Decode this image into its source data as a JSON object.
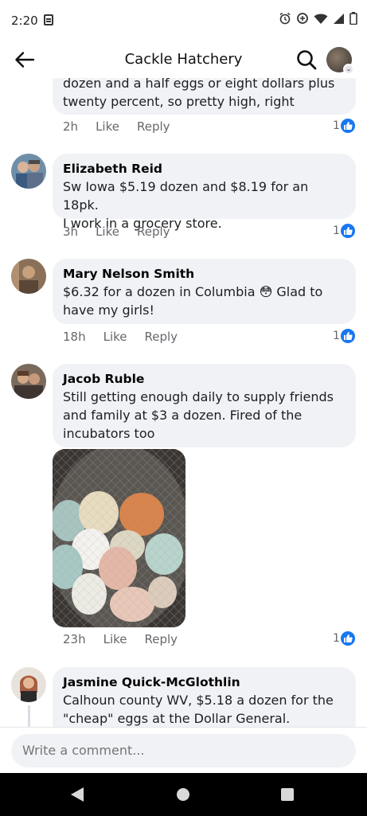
{
  "status_bar": {
    "time": "2:20"
  },
  "header": {
    "title": "Cackle Hatchery"
  },
  "comments": [
    {
      "author": "",
      "text_lines": [
        "dozen and a half eggs or eight dollars plus",
        "twenty percent, so pretty high, right"
      ],
      "time": "2h",
      "like_label": "Like",
      "reply_label": "Reply",
      "reactions": "1"
    },
    {
      "author": "Elizabeth Reid",
      "text_lines": [
        "Sw Iowa $5.19 dozen and $8.19 for an 18pk.",
        "I work in a grocery store."
      ],
      "time": "3h",
      "like_label": "Like",
      "reply_label": "Reply",
      "reactions": "1"
    },
    {
      "author": "Mary Nelson Smith",
      "text_lines": [
        "$6.32 for a dozen in Columbia 😳 Glad to",
        "have my girls!"
      ],
      "time": "18h",
      "like_label": "Like",
      "reply_label": "Reply",
      "reactions": "1"
    },
    {
      "author": "Jacob Ruble",
      "text_lines": [
        "Still getting enough daily to supply friends",
        "and family at $3 a dozen. Fired of the",
        "incubators too"
      ],
      "time": "23h",
      "like_label": "Like",
      "reply_label": "Reply",
      "reactions": "1"
    },
    {
      "author": "Jasmine Quick-McGlothlin",
      "text_lines": [
        "Calhoun county WV, $5.18 a dozen for the",
        "\"cheap\" eggs at the Dollar General."
      ]
    }
  ],
  "composer": {
    "placeholder": "Write a comment..."
  },
  "colors": {
    "like_blue": "#1877f2",
    "bubble": "#f0f2f5",
    "meta_text": "#65676b"
  }
}
